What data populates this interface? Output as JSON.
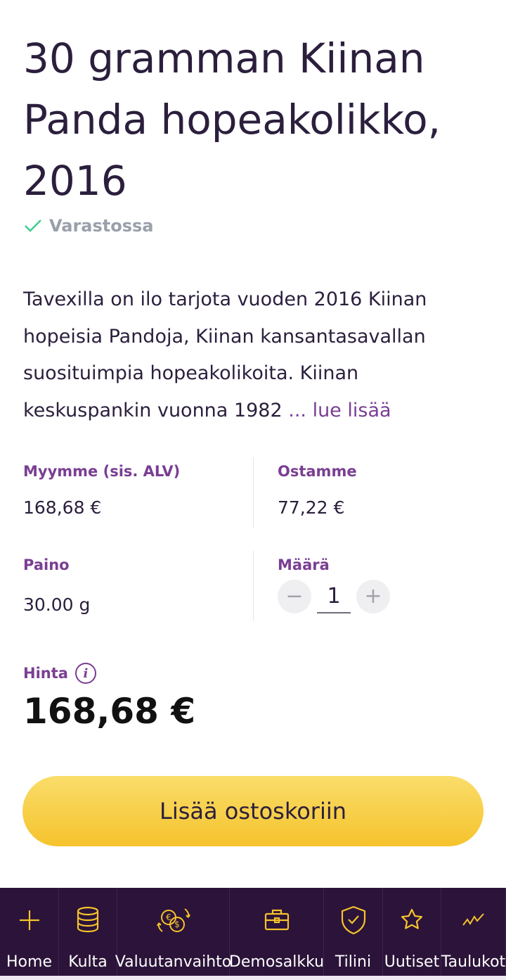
{
  "product": {
    "title": "30 gramman Kiinan Panda hopeakolikko, 2016",
    "stock_status": "Varastossa",
    "description": "Tavexilla on ilo tarjota vuoden 2016 Kiinan hopeisia Pandoja, Kiinan kansantasavallan suosituimpia hopeakolikoita. Kiinan keskuspankin vuonna 1982",
    "read_more": "... lue lisää"
  },
  "details": {
    "sell_label": "Myymme (sis. ALV)",
    "sell_value": "168,68 €",
    "buy_label": "Ostamme",
    "buy_value": "77,22 €",
    "weight_label": "Paino",
    "weight_value": "30.00 g",
    "quantity_label": "Määrä",
    "quantity_value": "1",
    "minus_symbol": "−",
    "plus_symbol": "+"
  },
  "price": {
    "label": "Hinta",
    "info_symbol": "i",
    "value": "168,68 €"
  },
  "cart_button_label": "Lisää ostoskoriin",
  "nav": {
    "items": [
      {
        "label": "Home",
        "icon": "plus-icon"
      },
      {
        "label": "Kulta",
        "icon": "coin-stack-icon"
      },
      {
        "label": "Valuutanvaihto",
        "icon": "currency-exchange-icon"
      },
      {
        "label": "Demosalkku",
        "icon": "briefcase-icon"
      },
      {
        "label": "Tilini",
        "icon": "shield-check-icon"
      },
      {
        "label": "Uutiset",
        "icon": "star-icon"
      },
      {
        "label": "Taulukot",
        "icon": "chart-line-icon"
      }
    ]
  },
  "colors": {
    "accent_purple": "#7a3e93",
    "nav_background": "#2b1339",
    "nav_icon": "#f5c32c",
    "button_yellow": "#f5c32c",
    "stock_check": "#3ccf8e"
  }
}
